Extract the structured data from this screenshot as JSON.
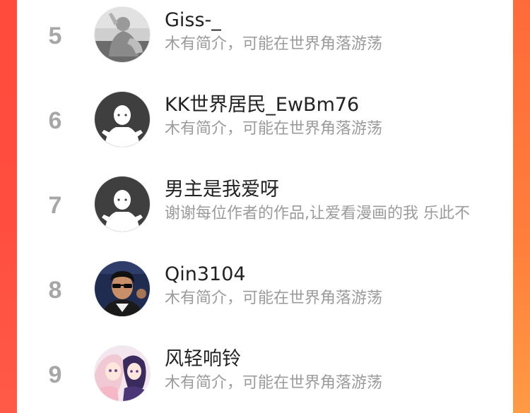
{
  "colors": {
    "left_edge": "#ff4b3c",
    "right_edge": "#ff7f3c",
    "rank": "#a7a7a7",
    "name": "#222222",
    "bio": "#9b9b9b"
  },
  "users": [
    {
      "rank": "5",
      "name": "Giss-_",
      "bio": "木有简介，可能在世界角落游荡",
      "avatar_icon": "photo-avatar-gray-figure"
    },
    {
      "rank": "6",
      "name": "KK世界居民_EwBm76",
      "bio": "木有简介，可能在世界角落游荡",
      "avatar_icon": "default-ghost-avatar"
    },
    {
      "rank": "7",
      "name": "男主是我爱呀",
      "bio": "谢谢每位作者的作品,让爱看漫画的我 乐此不",
      "avatar_icon": "default-ghost-avatar"
    },
    {
      "rank": "8",
      "name": "Qin3104",
      "bio": "木有简介，可能在世界角落游荡",
      "avatar_icon": "photo-avatar-sunglasses"
    },
    {
      "rank": "9",
      "name": "风轻响铃",
      "bio": "木有简介，可能在世界角落游荡",
      "avatar_icon": "anime-avatar"
    }
  ]
}
